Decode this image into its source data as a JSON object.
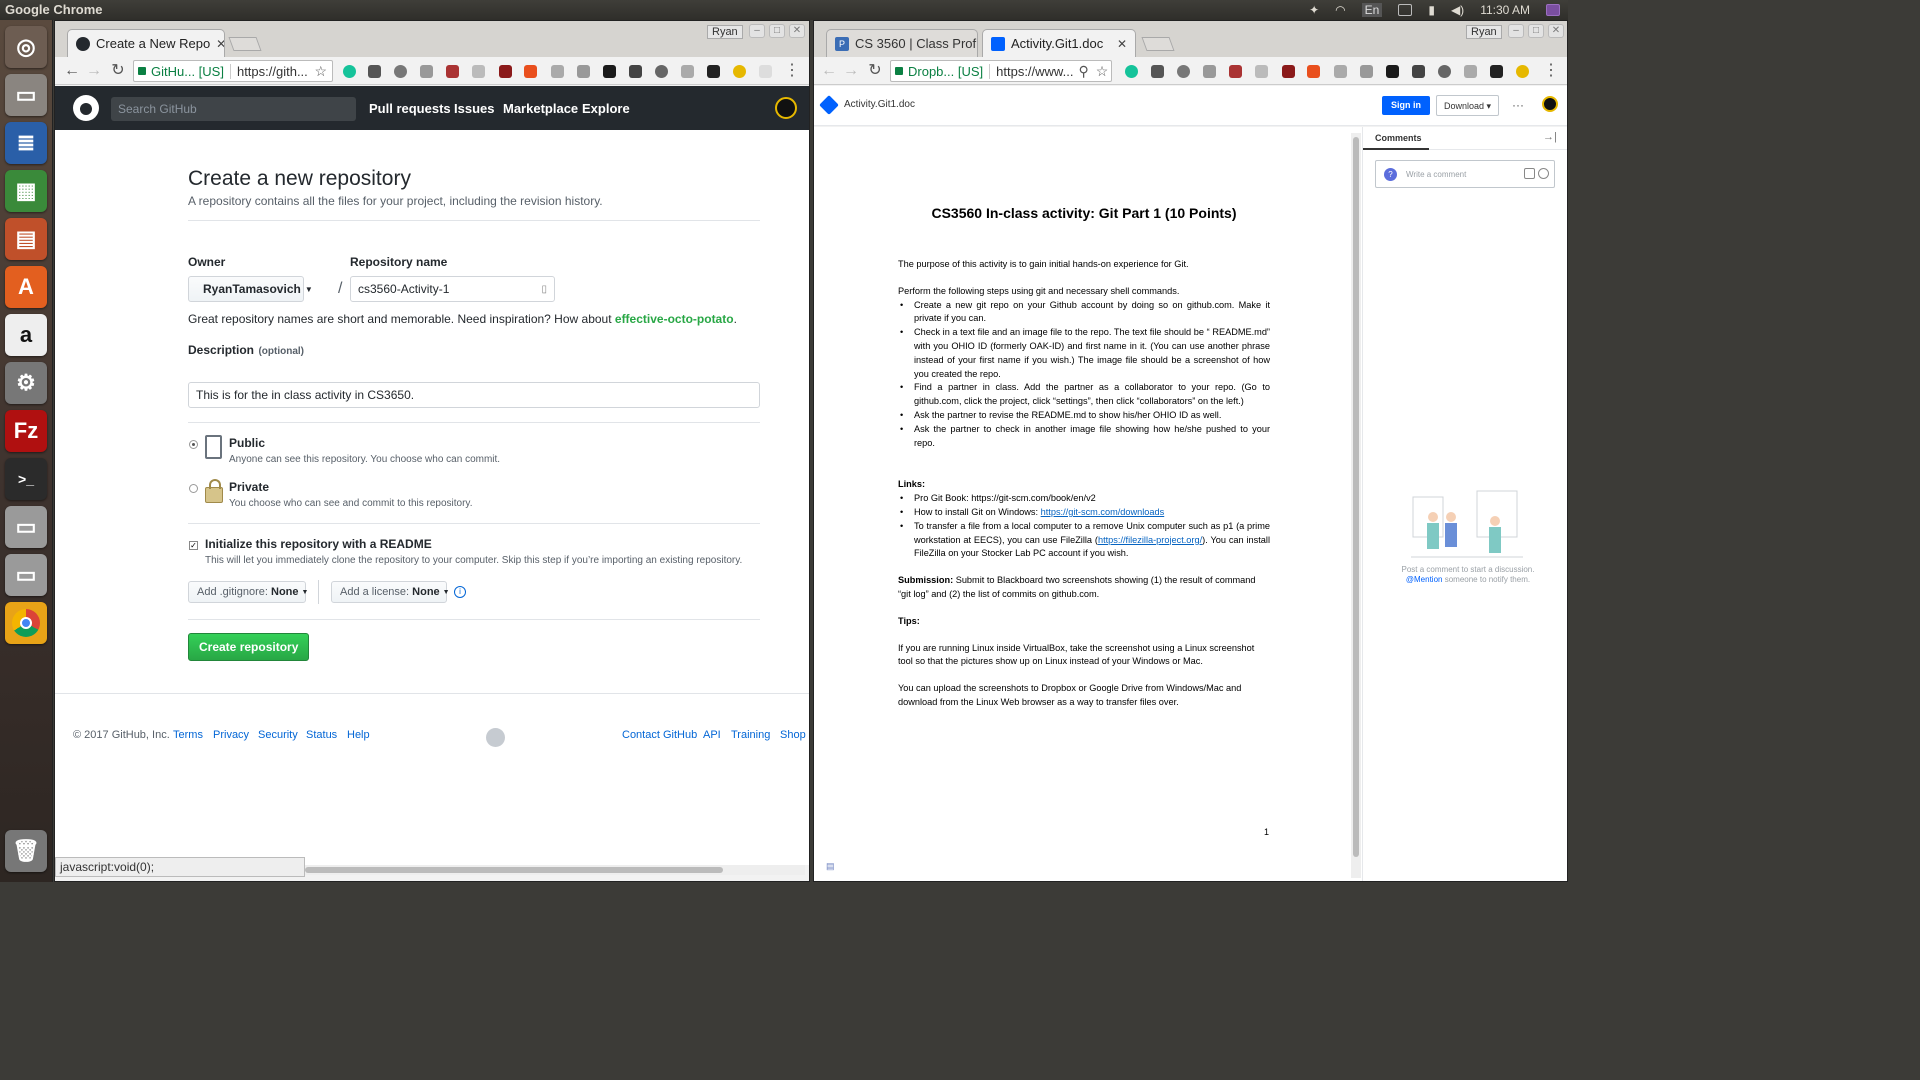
{
  "desktop": {
    "app_title": "Google Chrome",
    "lang": "En",
    "clock": "11:30 AM"
  },
  "left_window": {
    "profile": "Ryan",
    "tab_title": "Create a New Repo",
    "omnibox_secure": "GitHu... [US]",
    "omnibox_url": "https://gith...",
    "github": {
      "search_placeholder": "Search GitHub",
      "nav": [
        "Pull requests",
        "Issues",
        "Marketplace",
        "Explore"
      ],
      "page_title": "Create a new repository",
      "page_subtitle": "A repository contains all the files for your project, including the revision history.",
      "owner_label": "Owner",
      "owner_value": "RyanTamasovich",
      "slash": "/",
      "repo_label": "Repository name",
      "repo_value": "cs3560-Activity-1",
      "name_hint_prefix": "Great repository names are short and memorable. Need inspiration? How about ",
      "name_hint_suggestion": "effective-octo-potato",
      "name_hint_suffix": ".",
      "description_label": "Description",
      "description_optional": "(optional)",
      "description_value": "This is for the in class activity in CS3650.",
      "public_title": "Public",
      "public_desc": "Anyone can see this repository. You choose who can commit.",
      "private_title": "Private",
      "private_desc": "You choose who can see and commit to this repository.",
      "init_title": "Initialize this repository with a README",
      "init_desc": "This will let you immediately clone the repository to your computer. Skip this step if you’re importing an existing repository.",
      "gitignore_label": "Add .gitignore:",
      "gitignore_value": "None",
      "license_label": "Add a license:",
      "license_value": "None",
      "create_button": "Create repository",
      "footer_copyright": "© 2017 GitHub, Inc.",
      "footer_left": [
        "Terms",
        "Privacy",
        "Security",
        "Status",
        "Help"
      ],
      "footer_right": [
        "Contact GitHub",
        "API",
        "Training",
        "Shop"
      ]
    },
    "status_text": "javascript:void(0);"
  },
  "right_window": {
    "profile": "Ryan",
    "tabs": [
      "CS 3560 | Class Prof",
      "Activity.Git1.doc"
    ],
    "omnibox_secure": "Dropb... [US]",
    "omnibox_url": "https://www...",
    "dropbox": {
      "file_name": "Activity.Git1.doc",
      "sign_in": "Sign in",
      "download": "Download ▾",
      "more": "···",
      "comments_title": "Comments",
      "comment_placeholder": "Write a comment",
      "hint_line1": "Post a comment to start a discussion.",
      "hint_mention": "@Mention",
      "hint_line2_rest": " someone to notify them."
    },
    "document": {
      "title": "CS3560 In-class activity: Git Part 1 (10 Points)",
      "purpose": "The purpose of this activity is to gain initial hands-on experience for Git.",
      "steps_intro": "Perform the following steps using git and necessary shell commands.",
      "steps": [
        "Create a new git repo on your Github account by doing so on github.com. Make it private if you can.",
        "Check in a text file and an image file to the repo. The text file should be “ README.md” with you OHIO ID (formerly OAK-ID) and first name in it. (You can use another phrase instead of your first name if you wish.) The image file should be a screenshot of how you created the repo.",
        "Find a partner in class. Add the partner as a collaborator to your repo. (Go to github.com, click the project, click “settings”, then click “collaborators” on the left.)",
        "Ask the partner to revise the README.md to show his/her OHIO ID as well.",
        "Ask the partner to check in another image file showing how he/she pushed to your repo."
      ],
      "links_heading": "Links:",
      "link1": "Pro Git Book: https://git-scm.com/book/en/v2",
      "link2_prefix": "How to install Git on Windows: ",
      "link2_url": "https://git-scm.com/downloads",
      "link3_prefix": "To transfer a file from a local computer to a remove Unix computer such as p1 (a prime workstation at EECS), you can use FileZilla (",
      "link3_url": "https://filezilla-project.org/",
      "link3_suffix": "). You can install FileZilla on your Stocker Lab PC account if you wish.",
      "submission_heading": "Submission:",
      "submission_text": " Submit to Blackboard two screenshots showing (1) the result of command “git log” and (2) the list of commits on github.com.",
      "tips_heading": "Tips:",
      "tip1": "If you are running Linux inside VirtualBox, take the screenshot using a Linux screenshot tool so that the pictures show up on Linux instead of your Windows or Mac.",
      "tip2": "You can upload the screenshots to Dropbox or Google Drive from Windows/Mac and download from the Linux Web browser as a way to transfer files over.",
      "page_number": "1"
    }
  },
  "colors": {
    "github_header": "#24292e",
    "github_green": "#28a745",
    "link_blue": "#0366d6",
    "dropbox_blue": "#0061fe"
  }
}
